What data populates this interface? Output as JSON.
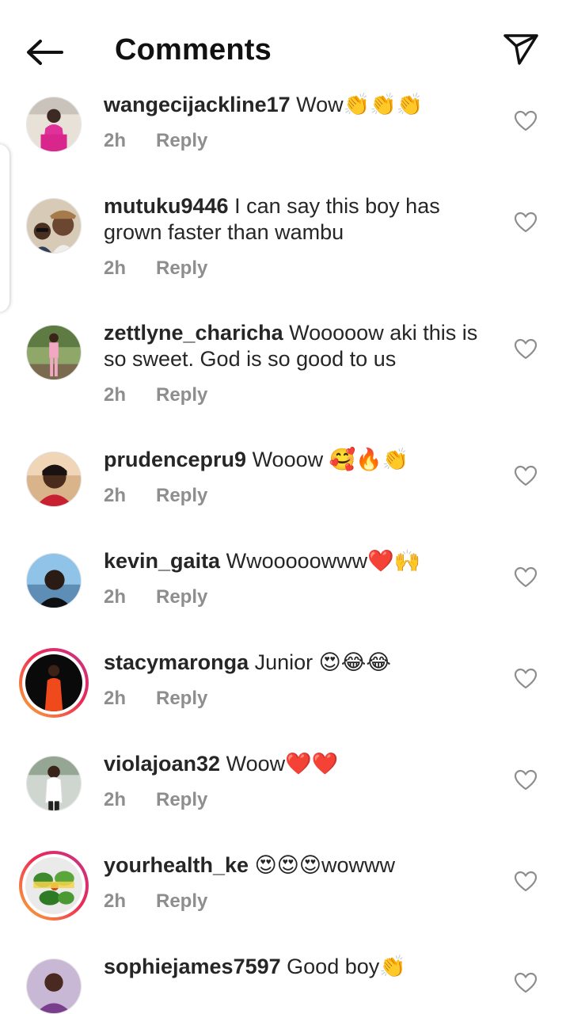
{
  "header": {
    "title": "Comments"
  },
  "comments": [
    {
      "username": "wangecijackline17",
      "text": "Wow👏👏👏",
      "time": "2h",
      "reply_label": "Reply"
    },
    {
      "username": "mutuku9446",
      "text": "I can say this boy has grown faster than wambu",
      "time": "2h",
      "reply_label": "Reply"
    },
    {
      "username": "zettlyne_charicha",
      "text": "Wooooow aki this is so sweet. God is so good to us",
      "time": "2h",
      "reply_label": "Reply"
    },
    {
      "username": "prudencepru9",
      "text": "Wooow 🥰🔥👏",
      "time": "2h",
      "reply_label": "Reply"
    },
    {
      "username": "kevin_gaita",
      "text": "Wwooooowww❤️🙌",
      "time": "2h",
      "reply_label": "Reply"
    },
    {
      "username": "stacymaronga",
      "text": "Junior 😍😂😂",
      "time": "2h",
      "reply_label": "Reply"
    },
    {
      "username": "violajoan32",
      "text": "Woow❤️❤️",
      "time": "2h",
      "reply_label": "Reply"
    },
    {
      "username": "yourhealth_ke",
      "text": "😍😍😍wowww",
      "time": "2h",
      "reply_label": "Reply"
    },
    {
      "username": "sophiejames7597",
      "text": "Good boy👏",
      "time": "",
      "reply_label": ""
    }
  ],
  "icons": {
    "back": "arrow-left-icon",
    "share": "paper-plane-icon",
    "like": "heart-outline-icon"
  },
  "colors": {
    "text": "#262626",
    "secondary": "#8e8e8e",
    "story_ring_start": "#f9b233",
    "story_ring_end": "#c1338c"
  }
}
